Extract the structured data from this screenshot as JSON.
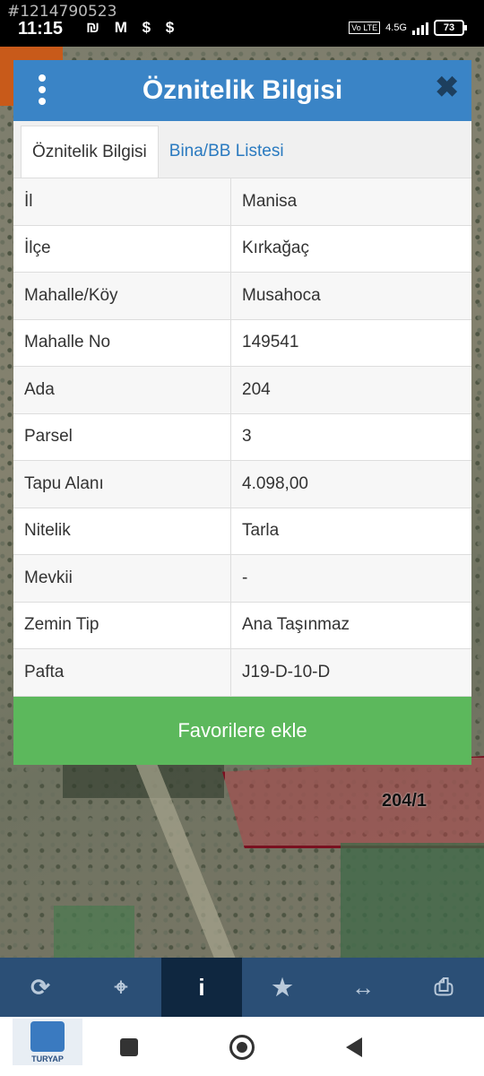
{
  "status_bar": {
    "watermark": "#1214790523",
    "time": "11:15",
    "left_icons": "₪ M $ $",
    "lte": "Vo LTE",
    "network": "4.5G",
    "battery": "73"
  },
  "map": {
    "parcel_label": "204/1"
  },
  "modal": {
    "title": "Öznitelik Bilgisi",
    "close_symbol": "✖",
    "tabs": [
      {
        "label": "Öznitelik Bilgisi",
        "active": true
      },
      {
        "label": "Bina/BB Listesi",
        "active": false
      }
    ],
    "rows": [
      {
        "key": "İl",
        "value": "Manisa"
      },
      {
        "key": "İlçe",
        "value": "Kırkağaç"
      },
      {
        "key": "Mahalle/Köy",
        "value": "Musahoca"
      },
      {
        "key": "Mahalle No",
        "value": "149541"
      },
      {
        "key": "Ada",
        "value": "204"
      },
      {
        "key": "Parsel",
        "value": "3"
      },
      {
        "key": "Tapu Alanı",
        "value": "4.098,00"
      },
      {
        "key": "Nitelik",
        "value": "Tarla"
      },
      {
        "key": "Mevkii",
        "value": "-"
      },
      {
        "key": "Zemin Tip",
        "value": "Ana Taşınmaz"
      },
      {
        "key": "Pafta",
        "value": "J19-D-10-D"
      }
    ],
    "favorite_button": "Favorilere ekle"
  },
  "toolbar": {
    "items": [
      {
        "icon": "refresh-icon",
        "glyph": "⟳",
        "active": false
      },
      {
        "icon": "crosshair-icon",
        "glyph": "⌖",
        "active": false
      },
      {
        "icon": "info-icon",
        "glyph": "i",
        "active": true
      },
      {
        "icon": "star-icon",
        "glyph": "★",
        "active": false
      },
      {
        "icon": "measure-icon",
        "glyph": "↔",
        "active": false
      },
      {
        "icon": "print-icon",
        "glyph": "⎙",
        "active": false
      }
    ]
  },
  "navbar": {
    "logo_text": "TURYAP"
  },
  "colors": {
    "header_blue": "#3a84c6",
    "tab_link_blue": "#2a7ac0",
    "button_green": "#5cb85c",
    "toolbar_blue": "#2b4f76",
    "toolbar_active": "#0f2740"
  }
}
